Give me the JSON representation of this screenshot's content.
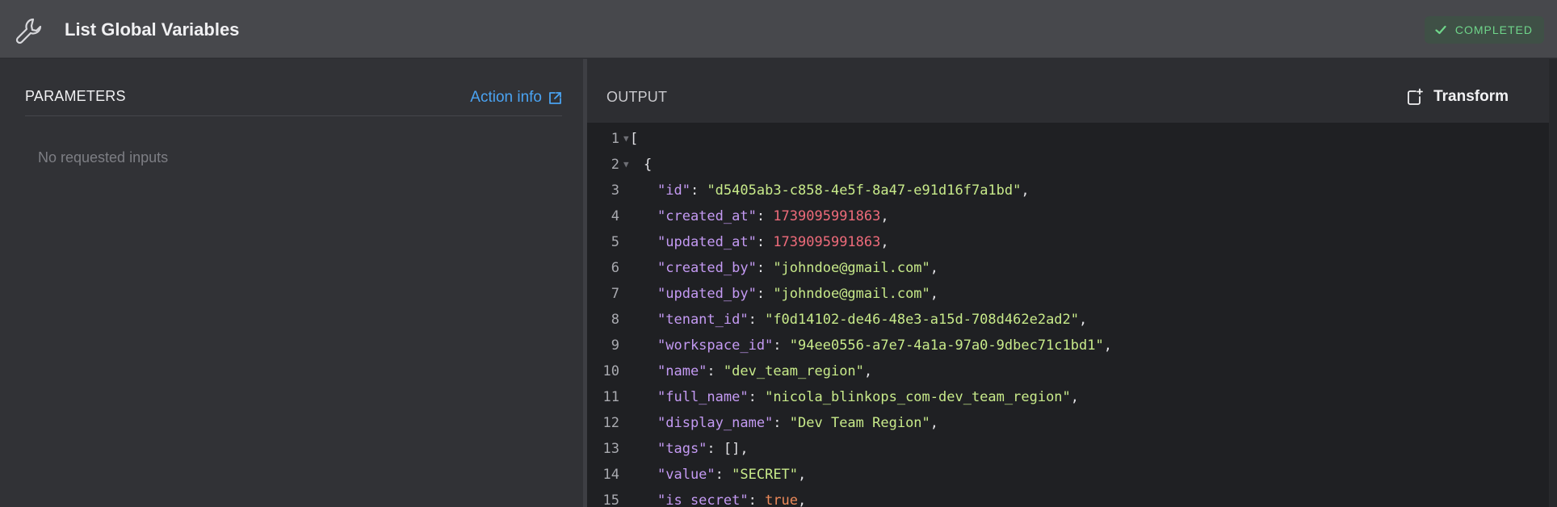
{
  "header": {
    "title": "List Global Variables",
    "status": "COMPLETED"
  },
  "colors": {
    "accent_link": "#4aa3f2",
    "status_green": "#6fd58a",
    "key": "#c49af3",
    "string": "#c8ea8a",
    "number": "#ee6b7a"
  },
  "parameters": {
    "title": "PARAMETERS",
    "action_info": "Action info",
    "empty_text": "No requested inputs"
  },
  "output": {
    "title": "OUTPUT",
    "transform_label": "Transform",
    "lines": [
      {
        "n": "1",
        "fold": true,
        "tokens": [
          {
            "t": "br",
            "v": "["
          }
        ]
      },
      {
        "n": "2",
        "fold": true,
        "indent": 1,
        "tokens": [
          {
            "t": "br",
            "v": "{"
          }
        ]
      },
      {
        "n": "3",
        "indent": 2,
        "tokens": [
          {
            "t": "k",
            "v": "\"id\""
          },
          {
            "t": "p",
            "v": ": "
          },
          {
            "t": "s",
            "v": "\"d5405ab3-c858-4e5f-8a47-e91d16f7a1bd\""
          },
          {
            "t": "p",
            "v": ","
          }
        ]
      },
      {
        "n": "4",
        "indent": 2,
        "tokens": [
          {
            "t": "k",
            "v": "\"created_at\""
          },
          {
            "t": "p",
            "v": ": "
          },
          {
            "t": "n",
            "v": "1739095991863"
          },
          {
            "t": "p",
            "v": ","
          }
        ]
      },
      {
        "n": "5",
        "indent": 2,
        "tokens": [
          {
            "t": "k",
            "v": "\"updated_at\""
          },
          {
            "t": "p",
            "v": ": "
          },
          {
            "t": "n",
            "v": "1739095991863"
          },
          {
            "t": "p",
            "v": ","
          }
        ]
      },
      {
        "n": "6",
        "indent": 2,
        "tokens": [
          {
            "t": "k",
            "v": "\"created_by\""
          },
          {
            "t": "p",
            "v": ": "
          },
          {
            "t": "s",
            "v": "\"johndoe@gmail.com\""
          },
          {
            "t": "p",
            "v": ","
          }
        ]
      },
      {
        "n": "7",
        "indent": 2,
        "tokens": [
          {
            "t": "k",
            "v": "\"updated_by\""
          },
          {
            "t": "p",
            "v": ": "
          },
          {
            "t": "s",
            "v": "\"johndoe@gmail.com\""
          },
          {
            "t": "p",
            "v": ","
          }
        ]
      },
      {
        "n": "8",
        "indent": 2,
        "tokens": [
          {
            "t": "k",
            "v": "\"tenant_id\""
          },
          {
            "t": "p",
            "v": ": "
          },
          {
            "t": "s",
            "v": "\"f0d14102-de46-48e3-a15d-708d462e2ad2\""
          },
          {
            "t": "p",
            "v": ","
          }
        ]
      },
      {
        "n": "9",
        "indent": 2,
        "tokens": [
          {
            "t": "k",
            "v": "\"workspace_id\""
          },
          {
            "t": "p",
            "v": ": "
          },
          {
            "t": "s",
            "v": "\"94ee0556-a7e7-4a1a-97a0-9dbec71c1bd1\""
          },
          {
            "t": "p",
            "v": ","
          }
        ]
      },
      {
        "n": "10",
        "indent": 2,
        "tokens": [
          {
            "t": "k",
            "v": "\"name\""
          },
          {
            "t": "p",
            "v": ": "
          },
          {
            "t": "s",
            "v": "\"dev_team_region\""
          },
          {
            "t": "p",
            "v": ","
          }
        ]
      },
      {
        "n": "11",
        "indent": 2,
        "tokens": [
          {
            "t": "k",
            "v": "\"full_name\""
          },
          {
            "t": "p",
            "v": ": "
          },
          {
            "t": "s",
            "v": "\"nicola_blinkops_com-dev_team_region\""
          },
          {
            "t": "p",
            "v": ","
          }
        ]
      },
      {
        "n": "12",
        "indent": 2,
        "tokens": [
          {
            "t": "k",
            "v": "\"display_name\""
          },
          {
            "t": "p",
            "v": ": "
          },
          {
            "t": "s",
            "v": "\"Dev Team Region\""
          },
          {
            "t": "p",
            "v": ","
          }
        ]
      },
      {
        "n": "13",
        "indent": 2,
        "tokens": [
          {
            "t": "k",
            "v": "\"tags\""
          },
          {
            "t": "p",
            "v": ": "
          },
          {
            "t": "br",
            "v": "[]"
          },
          {
            "t": "p",
            "v": ","
          }
        ]
      },
      {
        "n": "14",
        "indent": 2,
        "tokens": [
          {
            "t": "k",
            "v": "\"value\""
          },
          {
            "t": "p",
            "v": ": "
          },
          {
            "t": "s",
            "v": "\"SECRET\""
          },
          {
            "t": "p",
            "v": ","
          }
        ]
      },
      {
        "n": "15",
        "indent": 2,
        "tokens": [
          {
            "t": "k",
            "v": "\"is_secret\""
          },
          {
            "t": "p",
            "v": ": "
          },
          {
            "t": "b",
            "v": "true"
          },
          {
            "t": "p",
            "v": ","
          }
        ]
      }
    ]
  }
}
